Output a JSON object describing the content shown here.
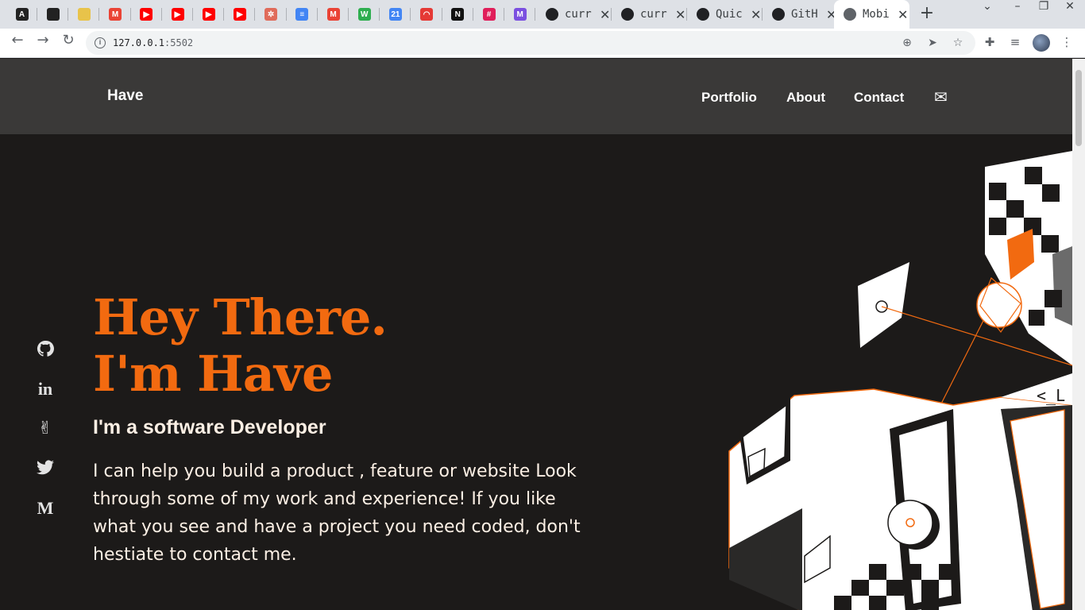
{
  "browser": {
    "pinned_tabs": [
      {
        "icon": "app-a-icon",
        "color": "#222222",
        "glyph": "A"
      },
      {
        "icon": "github-icon",
        "color": "#222222",
        "glyph": ""
      },
      {
        "icon": "colorful-wheel-icon",
        "color": "#e8c34a",
        "glyph": ""
      },
      {
        "icon": "gmail-icon",
        "color": "#ea4335",
        "glyph": "M"
      },
      {
        "icon": "youtube-icon",
        "color": "#ff0000",
        "glyph": "▶"
      },
      {
        "icon": "youtube-icon",
        "color": "#ff0000",
        "glyph": "▶"
      },
      {
        "icon": "youtube-icon",
        "color": "#ff0000",
        "glyph": "▶"
      },
      {
        "icon": "youtube-icon",
        "color": "#ff0000",
        "glyph": "▶"
      },
      {
        "icon": "openai-icon",
        "color": "#e06b5a",
        "glyph": "✲"
      },
      {
        "icon": "google-docs-icon",
        "color": "#4285f4",
        "glyph": "≡"
      },
      {
        "icon": "gmail-icon",
        "color": "#ea4335",
        "glyph": "M"
      },
      {
        "icon": "wordtune-icon",
        "color": "#2eae4f",
        "glyph": "W"
      },
      {
        "icon": "google-calendar-icon",
        "color": "#4285f4",
        "glyph": "21"
      },
      {
        "icon": "gauge-icon",
        "color": "#e53935",
        "glyph": "◠"
      },
      {
        "icon": "notion-icon",
        "color": "#111111",
        "glyph": "N"
      },
      {
        "icon": "slack-icon",
        "color": "#e01e5a",
        "glyph": "#"
      },
      {
        "icon": "app-m-icon",
        "color": "#7b4fe0",
        "glyph": "M"
      }
    ],
    "tabs": [
      {
        "title": "curr"
      },
      {
        "title": "curr"
      },
      {
        "title": "Quic"
      },
      {
        "title": "GitH"
      }
    ],
    "active_tab": {
      "title": "Mobi"
    },
    "url_host": "127.0.0.1",
    "url_port": ":5502"
  },
  "site": {
    "brand": "Have",
    "nav": {
      "portfolio": "Portfolio",
      "about": "About",
      "contact": "Contact"
    },
    "mail_icon": "envelope-icon",
    "hero": {
      "line1": "Hey There.",
      "line2": "I'm Have",
      "subtitle": "I'm a software Developer",
      "body": "I can help you build a product , feature or website Look through some of my work and experience! If you like what you see and have a project you need coded, don't hestiate to contact me."
    },
    "social": [
      "github-icon",
      "linkedin-icon",
      "angellist-icon",
      "twitter-icon",
      "medium-icon"
    ],
    "social_glyphs": [
      "",
      "in",
      "✌",
      "",
      "M"
    ],
    "accent": "#f26a10",
    "art_code_text": "<_L"
  }
}
